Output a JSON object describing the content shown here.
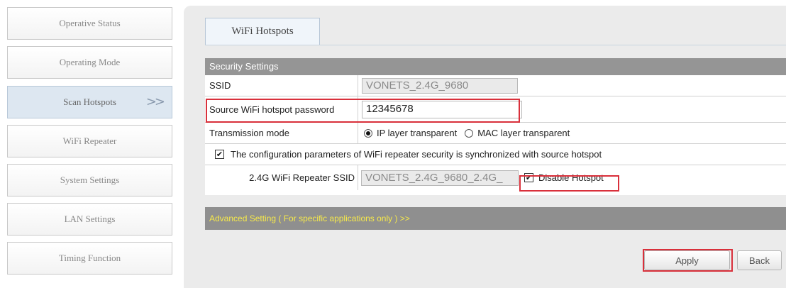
{
  "sidebar": {
    "items": [
      {
        "label": "Operative Status"
      },
      {
        "label": "Operating Mode"
      },
      {
        "label": "Scan Hotspots",
        "active": true,
        "arrow": ">>"
      },
      {
        "label": "WiFi Repeater"
      },
      {
        "label": "System Settings"
      },
      {
        "label": "LAN Settings"
      },
      {
        "label": "Timing Function"
      }
    ]
  },
  "tab": {
    "label": "WiFi Hotspots"
  },
  "security": {
    "header": "Security Settings",
    "ssid_label": "SSID",
    "ssid_value": "VONETS_2.4G_9680",
    "password_label": "Source WiFi hotspot password",
    "password_value": "12345678",
    "mode_label": "Transmission mode",
    "mode_options": [
      "IP layer transparent",
      "MAC layer transparent"
    ],
    "mode_selected": "IP layer transparent",
    "sync_label": "The configuration parameters of WiFi repeater security is synchronized with source hotspot",
    "sync_checked": true,
    "repeater_ssid_label": "2.4G WiFi Repeater SSID",
    "repeater_ssid_value": "VONETS_2.4G_9680_2.4G_",
    "disable_hotspot_label": "Disable Hotspot",
    "disable_hotspot_checked": true,
    "checkmark_glyph": "✔"
  },
  "advanced": {
    "label": "Advanced Setting ( For specific applications only ) >>"
  },
  "buttons": {
    "apply": "Apply",
    "back": "Back"
  },
  "colors": {
    "highlight": "#d9303b",
    "advanced_text": "#f6e94a",
    "header_bg": "#959595"
  }
}
